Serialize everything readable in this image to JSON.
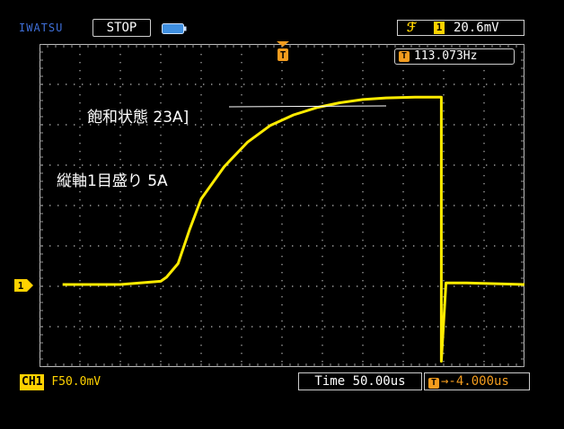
{
  "top_bar": {
    "brand": "IWATSU",
    "run_state": "STOP",
    "trigger_channel": "1",
    "trigger_level": "20.6mV",
    "battery_icon": "battery-icon",
    "trigger_edge_icon": "rising-edge-icon"
  },
  "screen": {
    "frequency": "113.073Hz",
    "frequency_marker": "T",
    "trigger_marker": "T",
    "channel_marker": "1"
  },
  "annotations": {
    "saturation": "飽和状態 23A]",
    "vertical_scale": "縦軸1目盛り 5A"
  },
  "bottom_bar": {
    "channel_label": "CH1",
    "channel_scale": "F50.0mV",
    "timebase": "Time 50.00us",
    "trigger_offset": "→-4.000us",
    "offset_marker": "T"
  },
  "colors": {
    "trace": "#ffeb00",
    "channel": "#ffd200",
    "orange": "#f39c1e",
    "brand": "#3f6fd8",
    "grid": "#9a9a9a"
  },
  "chart_data": {
    "type": "line",
    "series": [
      {
        "x_us": [
          -100,
          -50,
          -15,
          -10,
          0,
          10,
          20,
          40,
          60,
          80,
          100,
          120,
          140,
          160,
          180,
          205,
          228,
          228,
          232,
          250,
          300
        ],
        "y_A": [
          0.0,
          0.0,
          0.4,
          0.9,
          2.6,
          6.8,
          10.6,
          14.6,
          17.6,
          19.7,
          21.0,
          21.9,
          22.5,
          22.9,
          23.1,
          23.2,
          23.2,
          -9.5,
          0.2,
          0.2,
          0.0
        ]
      }
    ],
    "xlim": [
      -120,
      300
    ],
    "ylim": [
      -20,
      20
    ],
    "grid": true
  }
}
